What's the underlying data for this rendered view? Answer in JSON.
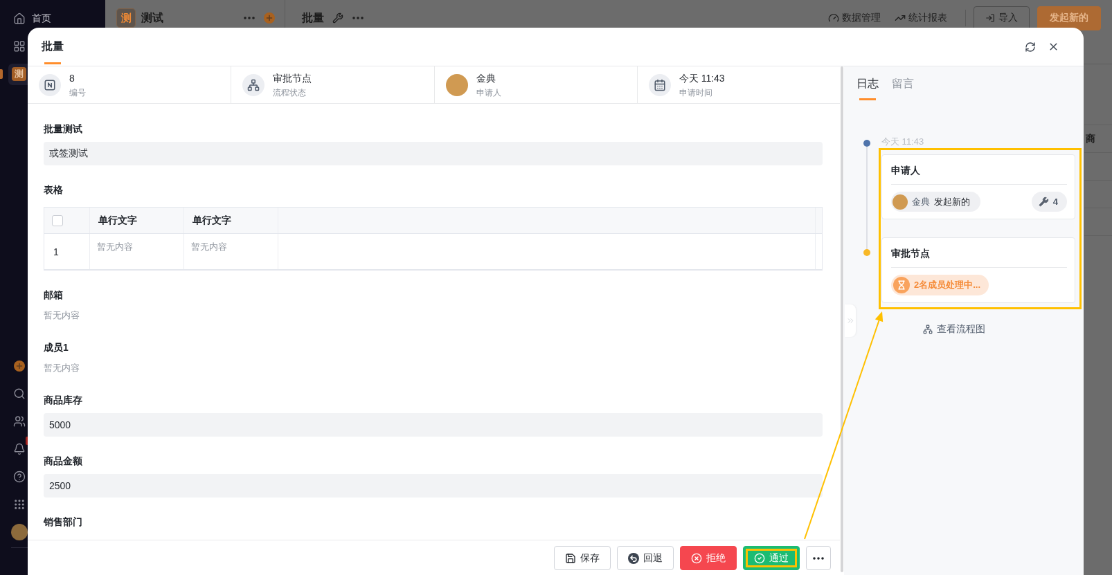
{
  "sidebar": {
    "nav": [
      {
        "kind": "link",
        "label": "首页",
        "selected": false
      },
      {
        "kind": "icon",
        "selected": false
      },
      {
        "kind": "tile",
        "label": "测",
        "selected": true
      }
    ],
    "notification_badge": true
  },
  "app_panel": {
    "icon_text": "测",
    "name": "测试"
  },
  "top_bar": {
    "title": "批量",
    "links": [
      "数据管理",
      "统计报表"
    ],
    "buttons": [
      {
        "kind": "outline",
        "label": "导入"
      },
      {
        "kind": "primary",
        "label": "发起新的"
      }
    ]
  },
  "background_table": {
    "column_1": "商"
  },
  "dialog": {
    "tabs": [
      {
        "label": "批量",
        "selected": true
      }
    ],
    "summary": [
      {
        "kind": "number",
        "value": "8",
        "label": "编号"
      },
      {
        "kind": "status",
        "value": "审批节点",
        "label": "流程状态"
      },
      {
        "kind": "person",
        "value": "金典",
        "label": "申请人"
      },
      {
        "kind": "time",
        "value": "今天 11:43",
        "label": "申请时间"
      }
    ],
    "fields": [
      {
        "kind": "input",
        "label": "批量测试",
        "value": "或签测试"
      },
      {
        "kind": "table",
        "label": "表格",
        "select_all_checked": false,
        "columns": [
          "单行文字",
          "单行文字"
        ],
        "rows": [
          {
            "index": "1",
            "cells": [
              "暂无内容",
              "暂无内容"
            ]
          }
        ]
      },
      {
        "kind": "empty",
        "label": "邮箱",
        "value": "暂无内容"
      },
      {
        "kind": "empty",
        "label": "成员1",
        "value": "暂无内容"
      },
      {
        "kind": "input",
        "label": "商品库存",
        "value": "5000"
      },
      {
        "kind": "input",
        "label": "商品金额",
        "value": "2500"
      },
      {
        "kind": "empty",
        "label": "销售部门"
      }
    ],
    "actions": [
      {
        "kind": "save",
        "label": "保存",
        "highlighted": false
      },
      {
        "kind": "back",
        "label": "回退",
        "highlighted": false
      },
      {
        "kind": "reject",
        "label": "拒绝",
        "highlighted": false
      },
      {
        "kind": "approve",
        "label": "通过",
        "highlighted": true
      }
    ],
    "side": {
      "tabs": [
        {
          "label": "日志",
          "selected": true
        },
        {
          "label": "留言",
          "selected": false
        }
      ],
      "timeline": {
        "highlighted": true,
        "entries": [
          {
            "kind": "submitted",
            "time": "今天 11:43",
            "title": "申请人",
            "color": "#4f74ab",
            "person": "金典",
            "action": "发起新的",
            "count": "4"
          },
          {
            "kind": "pending",
            "title": "审批节点",
            "color": "#f8b826",
            "status": "2名成员处理中..."
          }
        ]
      },
      "flow_link": "查看流程图"
    }
  }
}
